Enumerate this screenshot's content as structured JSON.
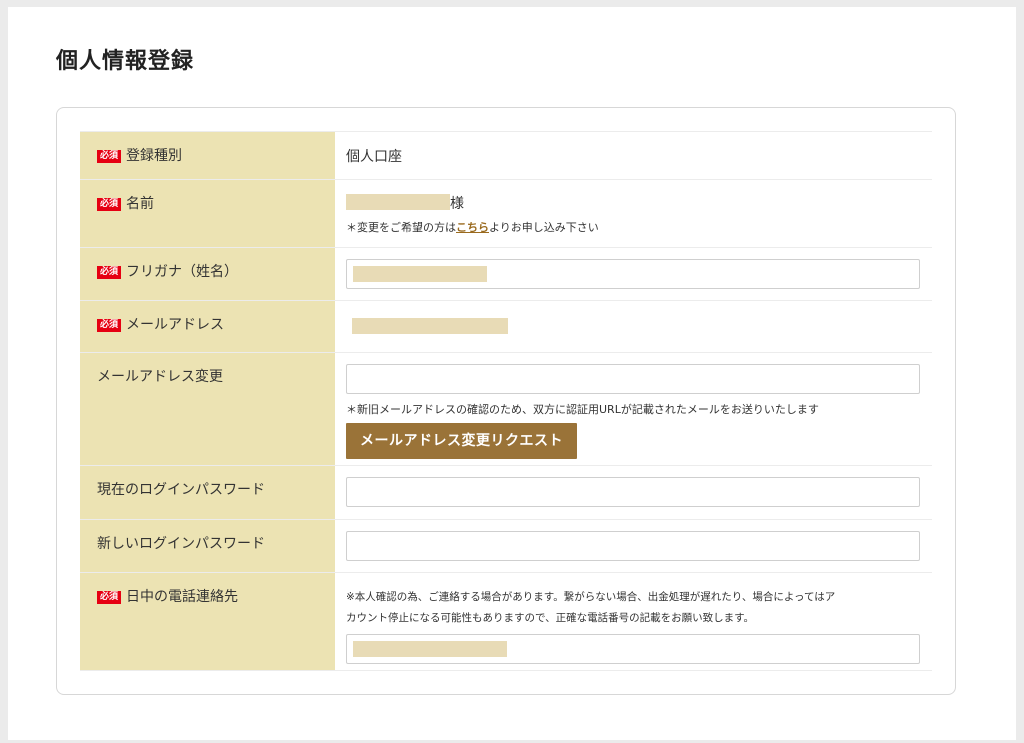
{
  "page_title": "個人情報登録",
  "required_badge": "必須",
  "rows": {
    "type": {
      "label": "登録種別",
      "value": "個人口座"
    },
    "name": {
      "label": "名前",
      "suffix": "様",
      "note_prefix": "＊変更をご希望の方は",
      "note_link": "こちら",
      "note_suffix": "よりお申し込み下さい"
    },
    "kana": {
      "label": "フリガナ（姓名）"
    },
    "email": {
      "label": "メールアドレス"
    },
    "email_change": {
      "label": "メールアドレス変更",
      "note": "＊新旧メールアドレスの確認のため、双方に認証用URLが記載されたメールをお送りいたします",
      "button": "メールアドレス変更リクエスト"
    },
    "current_password": {
      "label": "現在のログインパスワード"
    },
    "new_password": {
      "label": "新しいログインパスワード"
    },
    "phone": {
      "label": "日中の電話連絡先",
      "note_line1": "※本人確認の為、ご連絡する場合があります。繋がらない場合、出金処理が遅れたり、場合によってはア",
      "note_line2": "カウント停止になる可能性もありますので、正確な電話番号の記載をお願い致します。"
    }
  },
  "colors": {
    "label_bg": "#ece3b3",
    "required_red": "#e60012",
    "button_brown": "#9a7338",
    "link_brown": "#9a6a1e",
    "redaction": "#e8dbb6"
  }
}
